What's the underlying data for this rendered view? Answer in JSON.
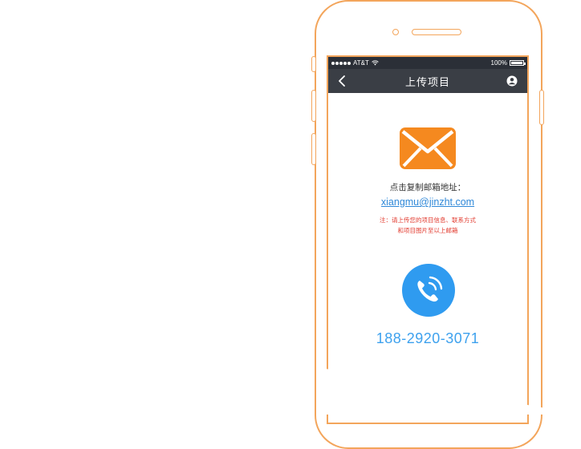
{
  "status_bar": {
    "carrier": "AT&T",
    "battery_text": "100%"
  },
  "navbar": {
    "title": "上传项目",
    "back_icon": "chevron-left-icon",
    "user_icon": "user-icon"
  },
  "main": {
    "mail_icon": "envelope-icon",
    "copy_label": "点击复制邮箱地址：",
    "email": "xiangmu@jinzht.com",
    "note_line1": "注：请上传您的项目信息、联系方式",
    "note_line2": "和项目图片至以上邮箱",
    "call_icon": "phone-call-icon",
    "phone_number": "188-2920-3071"
  },
  "colors": {
    "accent_orange": "#f3a55b",
    "mail_orange": "#f5891f",
    "navbar_bg": "#3a3e45",
    "link_blue": "#2f88d8",
    "call_blue": "#2f9bf0",
    "note_red": "#e23a2e"
  }
}
